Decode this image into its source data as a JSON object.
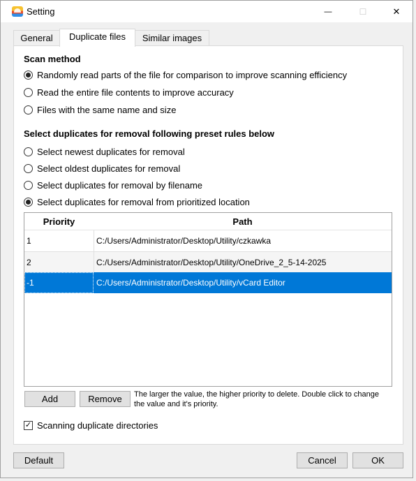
{
  "window": {
    "title": "Setting",
    "minimize_glyph": "—",
    "maximize_glyph": "☐",
    "close_glyph": "✕"
  },
  "tabs": [
    {
      "label": "General",
      "active": false
    },
    {
      "label": "Duplicate files",
      "active": true
    },
    {
      "label": "Similar images",
      "active": false
    }
  ],
  "scan_method": {
    "heading": "Scan method",
    "options": [
      {
        "label": "Randomly read parts of the file for comparison to improve scanning efficiency",
        "checked": true
      },
      {
        "label": "Read the entire file contents to improve accuracy",
        "checked": false
      },
      {
        "label": "Files with the same name and size",
        "checked": false
      }
    ]
  },
  "removal_rules": {
    "heading": "Select duplicates for removal following preset rules below",
    "options": [
      {
        "label": "Select newest duplicates for removal",
        "checked": false
      },
      {
        "label": "Select oldest duplicates for removal",
        "checked": false
      },
      {
        "label": "Select duplicates for removal by filename",
        "checked": false
      },
      {
        "label": "Select duplicates for removal from prioritized location",
        "checked": true
      }
    ]
  },
  "priority_table": {
    "columns": [
      "Priority",
      "Path"
    ],
    "rows": [
      {
        "priority": "1",
        "path": "C:/Users/Administrator/Desktop/Utility/czkawka"
      },
      {
        "priority": "2",
        "path": "C:/Users/Administrator/Desktop/Utility/OneDrive_2_5-14-2025"
      },
      {
        "priority": "-1",
        "path": "C:/Users/Administrator/Desktop/Utility/vCard Editor"
      }
    ],
    "selected_row": 2
  },
  "table_actions": {
    "add_label": "Add",
    "remove_label": "Remove",
    "hint": "The larger the value, the higher priority to delete. Double click to change the value and it's priority."
  },
  "scan_directories": {
    "label": "Scanning duplicate directories",
    "checked": true,
    "check_glyph": "✓"
  },
  "footer": {
    "default_label": "Default",
    "cancel_label": "Cancel",
    "ok_label": "OK"
  },
  "colors": {
    "selection": "#0078d7",
    "window_bg": "#f0f0f0",
    "panel_bg": "#ffffff"
  }
}
